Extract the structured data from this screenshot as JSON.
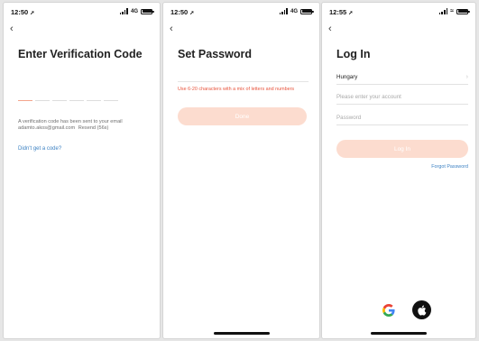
{
  "screens": [
    {
      "status": {
        "time": "12:50",
        "network": "4G"
      },
      "title": "Enter Verification Code",
      "code_length": 6,
      "info_text": "A verification code has been sent to your email adamto.akos@gmail.com",
      "resend_label": "Resend (56s)",
      "help_link": "Didn't get a code?"
    },
    {
      "status": {
        "time": "12:50",
        "network": "4G"
      },
      "title": "Set Password",
      "hint": "Use 6-20 characters with a mix of letters and numbers",
      "done_label": "Done"
    },
    {
      "status": {
        "time": "12:55"
      },
      "title": "Log In",
      "country": "Hungary",
      "account_placeholder": "Please enter your account",
      "password_placeholder": "Password",
      "login_label": "Log In",
      "forgot_label": "Forgot Password",
      "social": [
        "google-icon",
        "apple-icon"
      ]
    }
  ],
  "colors": {
    "accent_peach": "#fcdccf",
    "link_blue": "#3d82c3",
    "error_red": "#e8553e",
    "code_active": "#f4a58c"
  }
}
